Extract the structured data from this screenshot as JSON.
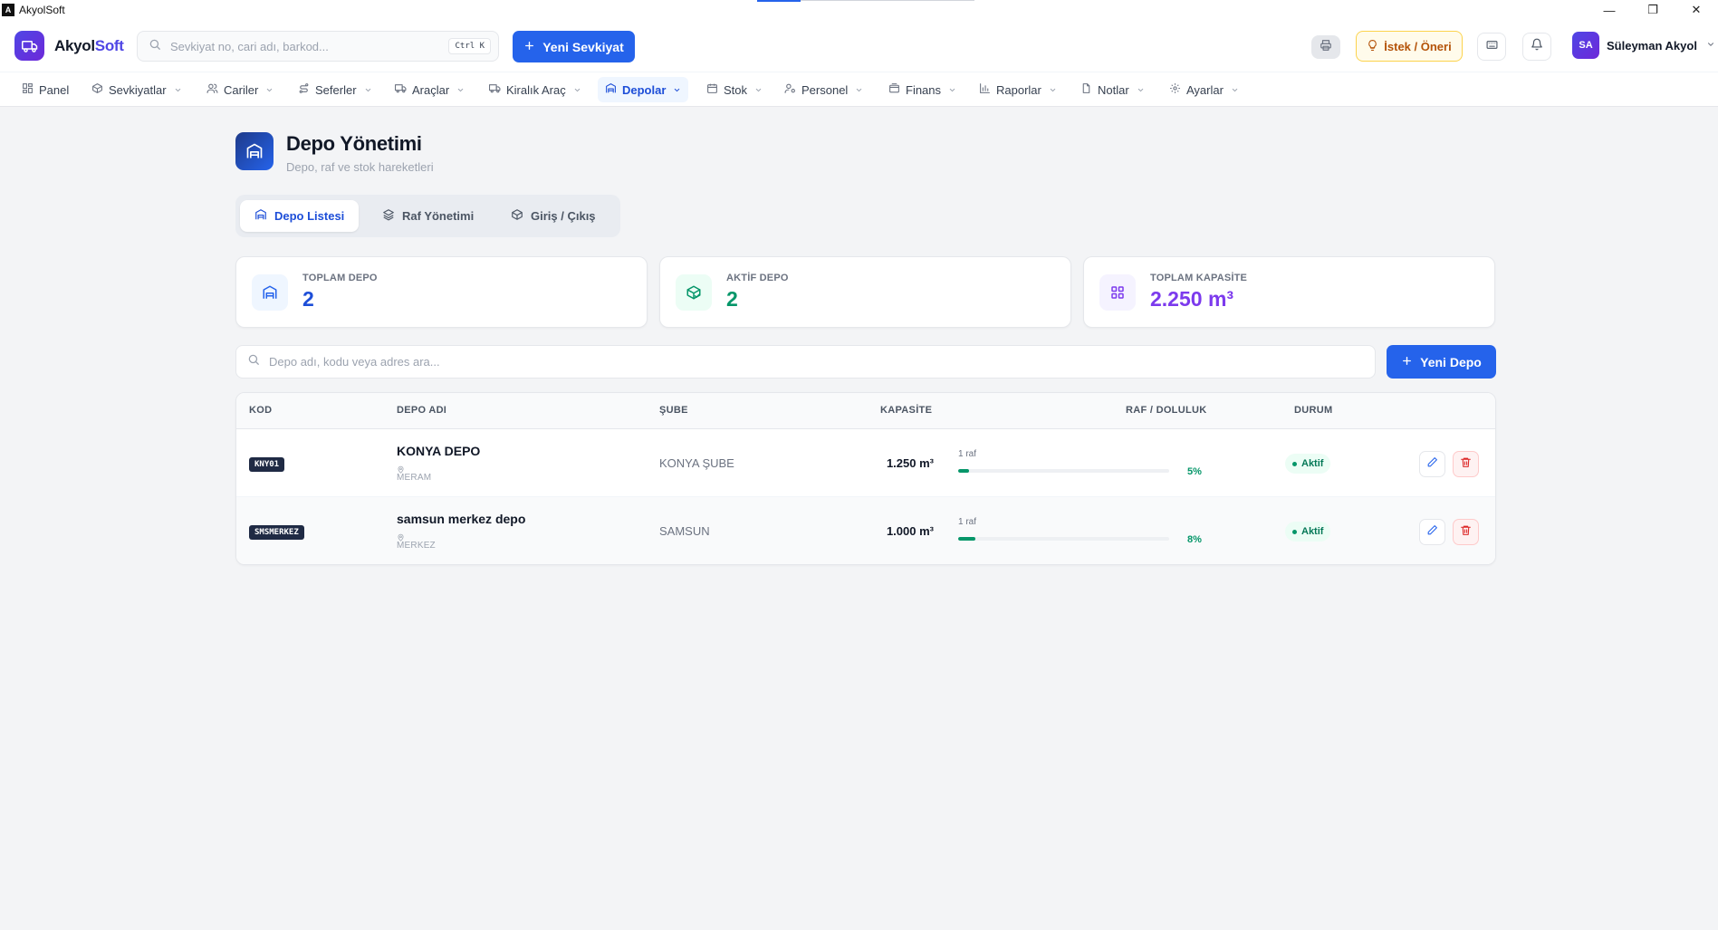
{
  "window": {
    "title": "AkyolSoft",
    "minimize": "—",
    "restore": "❐",
    "close": "✕"
  },
  "brand": {
    "name_main": "Akyol",
    "name_accent": "Soft"
  },
  "header": {
    "search_placeholder": "Sevkiyat no, cari adı, barkod...",
    "shortcut": "Ctrl K",
    "new_shipment": "Yeni Sevkiyat",
    "suggest": "İstek / Öneri",
    "user_initials": "SA",
    "user_name": "Süleyman Akyol"
  },
  "nav": {
    "items": [
      {
        "label": "Panel"
      },
      {
        "label": "Sevkiyatlar"
      },
      {
        "label": "Cariler"
      },
      {
        "label": "Seferler"
      },
      {
        "label": "Araçlar"
      },
      {
        "label": "Kiralık Araç"
      },
      {
        "label": "Depolar"
      },
      {
        "label": "Stok"
      },
      {
        "label": "Personel"
      },
      {
        "label": "Finans"
      },
      {
        "label": "Raporlar"
      },
      {
        "label": "Notlar"
      },
      {
        "label": "Ayarlar"
      }
    ],
    "active": "Depolar"
  },
  "page": {
    "title": "Depo Yönetimi",
    "subtitle": "Depo, raf ve stok hareketleri"
  },
  "tabs": [
    {
      "label": "Depo Listesi"
    },
    {
      "label": "Raf Yönetimi"
    },
    {
      "label": "Giriş / Çıkış"
    }
  ],
  "stats": [
    {
      "label": "TOPLAM DEPO",
      "value": "2",
      "color": "#1d4ed8"
    },
    {
      "label": "AKTİF DEPO",
      "value": "2",
      "color": "#059669"
    },
    {
      "label": "TOPLAM KAPASİTE",
      "value": "2.250 m³",
      "color": "#7c3aed"
    }
  ],
  "filter": {
    "search_placeholder": "Depo adı, kodu veya adres ara...",
    "new_depot": "Yeni Depo"
  },
  "table": {
    "headers": {
      "code": "KOD",
      "name": "DEPO ADI",
      "branch": "ŞUBE",
      "capacity": "KAPASİTE",
      "shelf": "RAF / DOLULUK",
      "status": "DURUM"
    },
    "rows": [
      {
        "code": "KNY01",
        "name": "KONYA DEPO",
        "address": "MERAM",
        "branch": "KONYA ŞUBE",
        "capacity": "1.250 m³",
        "shelves": "1 raf",
        "fill_pct": 5,
        "fill_label": "5%",
        "status": "Aktif"
      },
      {
        "code": "SMSMERKEZ",
        "name": "samsun merkez depo",
        "address": "MERKEZ",
        "branch": "SAMSUN",
        "capacity": "1.000 m³",
        "shelves": "1 raf",
        "fill_pct": 8,
        "fill_label": "8%",
        "status": "Aktif"
      }
    ]
  },
  "colors": {
    "primary": "#2563eb",
    "brand": "#4f46e5",
    "success": "#059669",
    "danger": "#dc2626",
    "warning": "#b45309"
  },
  "icons": {
    "brand": "truck-icon",
    "search": "search-icon",
    "plus": "plus-icon",
    "printer": "printer-icon",
    "lightbulb": "lightbulb-icon",
    "keyboard": "keyboard-icon",
    "bell": "bell-icon",
    "chevron": "chevron-down-icon",
    "warehouse": "warehouse-icon",
    "layers": "layers-icon",
    "box": "package-icon",
    "grid": "grid-icon",
    "pin": "map-pin-icon",
    "edit": "pencil-icon",
    "delete": "trash-icon"
  }
}
